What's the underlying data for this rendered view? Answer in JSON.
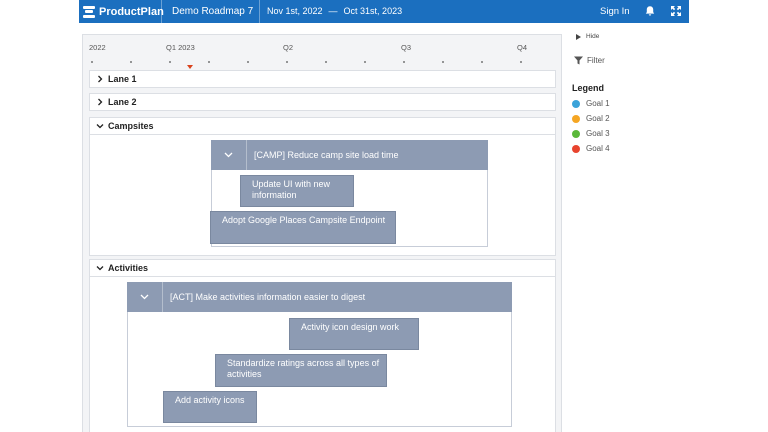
{
  "header": {
    "brand": "ProductPlan",
    "roadmap_name": "Demo Roadmap 7",
    "date_start": "Nov 1st, 2022",
    "date_sep": "—",
    "date_end": "Oct 31st, 2023",
    "signin": "Sign In"
  },
  "timeline": {
    "labels": [
      "2022",
      "Q1 2023",
      "Q2",
      "Q3",
      "Q4"
    ]
  },
  "lanes": {
    "lane1": {
      "label": "Lane 1"
    },
    "lane2": {
      "label": "Lane 2"
    },
    "campsites": {
      "label": "Campsites",
      "container": "[CAMP] Reduce camp site load time",
      "bars": [
        "Update UI with new information",
        "Adopt Google Places Campsite Endpoint"
      ]
    },
    "activities": {
      "label": "Activities",
      "container": "[ACT] Make activities information easier to digest",
      "bars": [
        "Activity icon design work",
        "Standardize ratings across all types of activities",
        "Add activity icons"
      ]
    }
  },
  "sidebar": {
    "hide": "Hide",
    "filter": "Filter",
    "legend_title": "Legend",
    "legend": [
      {
        "label": "Goal 1",
        "color": "#3ba3d9"
      },
      {
        "label": "Goal 2",
        "color": "#f5a623"
      },
      {
        "label": "Goal 3",
        "color": "#5bb83a"
      },
      {
        "label": "Goal 4",
        "color": "#e8442e"
      }
    ]
  }
}
